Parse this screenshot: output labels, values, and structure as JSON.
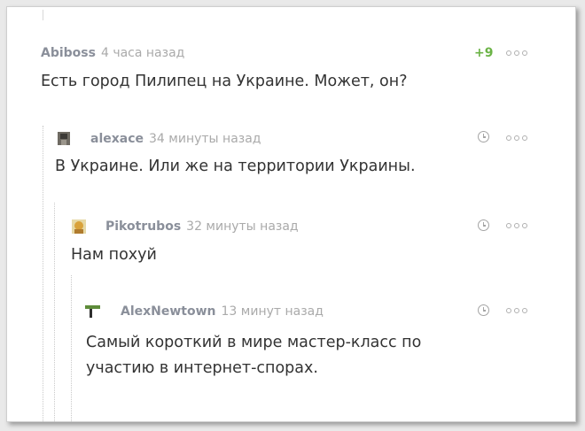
{
  "comments": [
    {
      "author": "Abiboss",
      "time": "4 часа назад",
      "rating": "+9",
      "text": "Есть город Пилипец на Украине. Может, он?"
    },
    {
      "author": "alexace",
      "time": "34 минуты назад",
      "text": "В Украине. Или же на территории Украины."
    },
    {
      "author": "Pikotrubos",
      "time": "32 минуты назад",
      "text": "Нам похуй"
    },
    {
      "author": "AlexNewtown",
      "time": "13 минут назад",
      "text_lines": [
        "Самый короткий в мире мастер-класс по",
        "участию в интернет-спорах."
      ]
    }
  ],
  "icons": {
    "clock": "clock-icon",
    "more": "more-dots-icon",
    "avatar": "avatar-icon"
  },
  "colors": {
    "rating": "#6bb346",
    "author": "#8a8f9a",
    "time": "#aaaaaa",
    "text": "#333333"
  }
}
